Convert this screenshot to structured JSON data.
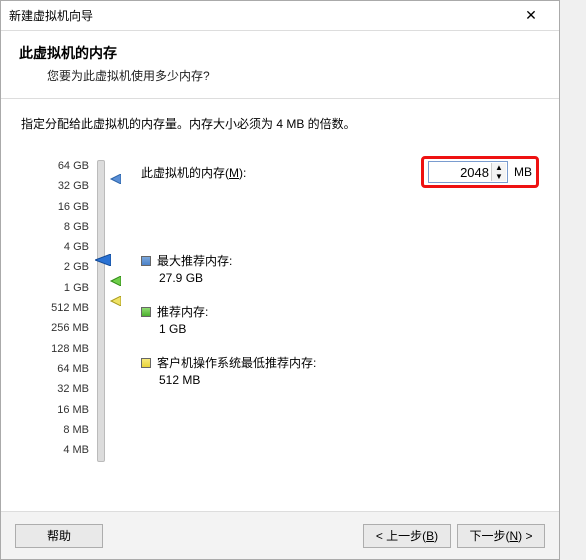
{
  "titlebar": {
    "title": "新建虚拟机向导",
    "close": "✕"
  },
  "header": {
    "heading": "此虚拟机的内存",
    "subheading": "您要为此虚拟机使用多少内存?"
  },
  "hint": "指定分配给此虚拟机的内存量。内存大小必须为 4 MB 的倍数。",
  "memory": {
    "label_prefix": "此虚拟机的内存(",
    "label_hotkey": "M",
    "label_suffix": "):",
    "value": "2048",
    "unit": "MB"
  },
  "scale": [
    "64 GB",
    "32 GB",
    "16 GB",
    "8 GB",
    "4 GB",
    "2 GB",
    "1 GB",
    "512 MB",
    "256 MB",
    "128 MB",
    "64 MB",
    "32 MB",
    "16 MB",
    "8 MB",
    "4 MB"
  ],
  "recs": {
    "max": {
      "title": "最大推荐内存:",
      "value": "27.9 GB"
    },
    "rec": {
      "title": "推荐内存:",
      "value": "1 GB"
    },
    "min": {
      "title": "客户机操作系统最低推荐内存:",
      "value": "512 MB"
    }
  },
  "buttons": {
    "help": "帮助",
    "back_prefix": "< 上一步(",
    "back_hotkey": "B",
    "back_suffix": ")",
    "next_prefix": "下一步(",
    "next_hotkey": "N",
    "next_suffix": ") >"
  }
}
